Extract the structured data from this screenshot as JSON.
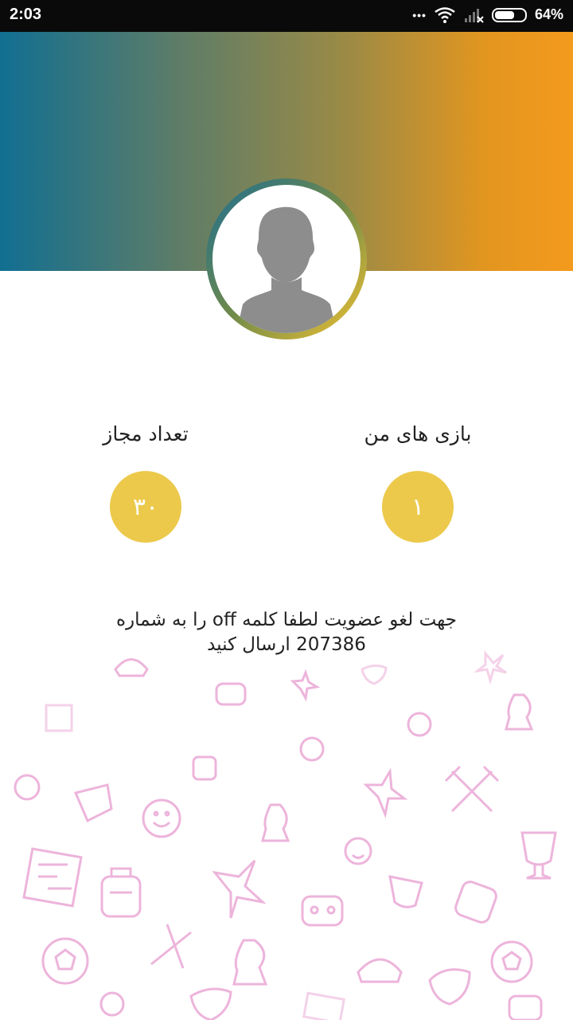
{
  "status_bar": {
    "time": "2:03",
    "dots": "•••",
    "battery": "64%"
  },
  "stats": {
    "allowed_label": "تعداد مجاز",
    "allowed_value": "۳۰",
    "my_games_label": "بازی های من",
    "my_games_value": "۱"
  },
  "message": {
    "text": "جهت لغو عضویت لطفا کلمه off را به شماره 207386 ارسال کنید"
  },
  "colors": {
    "accent": "#ecc94b",
    "gradient_start": "#116f92",
    "gradient_end": "#f49a1d",
    "pattern": "#e79ccf"
  }
}
